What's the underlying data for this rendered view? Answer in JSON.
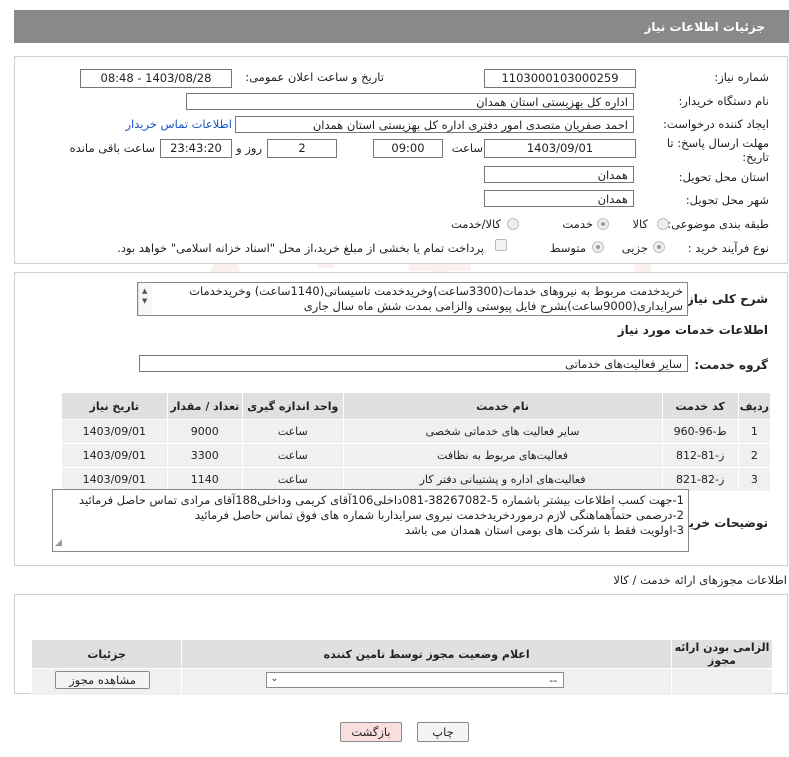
{
  "header": {
    "title": "جزئیات اطلاعات نیاز"
  },
  "form": {
    "need_number_label": "شماره نیاز:",
    "need_number": "1103000103000259",
    "announce_label": "تاریخ و ساعت اعلان عمومی:",
    "announce_value": "1403/08/28 - 08:48",
    "buyer_org_label": "نام دستگاه خریدار:",
    "buyer_org": "اداره کل بهزیستی استان همدان",
    "requester_label": "ایجاد کننده درخواست:",
    "requester": "احمد صفریان متصدی امور دفتری اداره کل بهزیستی استان همدان",
    "contact_link": "اطلاعات تماس خریدار",
    "deadline_label_1": "مهلت ارسال پاسخ: تا",
    "deadline_label_2": "تاریخ:",
    "deadline_date": "1403/09/01",
    "time_label": "ساعت",
    "deadline_time": "09:00",
    "days_value": "2",
    "days_label": "روز و",
    "remaining_time": "23:43:20",
    "remaining_label": "ساعت باقی مانده",
    "province_label": "استان محل تحویل:",
    "province": "همدان",
    "city_label": "شهر محل تحویل:",
    "city": "همدان",
    "category_label": "طبقه بندی موضوعی:",
    "category_options": [
      "کالا",
      "خدمت",
      "کالا/خدمت"
    ],
    "category_selected": "خدمت",
    "process_label": "نوع فرآیند خرید :",
    "process_options": [
      "جزیی",
      "متوسط"
    ],
    "process_selected": "جزیی",
    "payment_note": "پرداخت تمام یا بخشی از مبلغ خرید،از محل \"اسناد خزانه اسلامی\" خواهد بود."
  },
  "summary": {
    "label": "شرح کلی نیاز:",
    "line1": "خریدخدمت مربوط به نیروهای خدمات(3300ساعت)وخریدخدمت تاسیساتی(1140ساعت) وخریدخدمات",
    "line2": "سرایداری(9000ساعت)بشرح فایل پیوستی والزامی بمدت شش ماه سال جاری"
  },
  "services": {
    "section_title": "اطلاعات خدمات مورد نیاز",
    "group_label": "گروه خدمت:",
    "group_value": "سایر فعالیت‌های خدماتی",
    "columns": [
      "ردیف",
      "کد خدمت",
      "نام خدمت",
      "واحد اندازه گیری",
      "تعداد / مقدار",
      "تاریخ نیاز"
    ],
    "rows": [
      [
        "1",
        "ط-96-960",
        "سایر فعالیت های خدماتی شخصی",
        "ساعت",
        "9000",
        "1403/09/01"
      ],
      [
        "2",
        "ز-81-812",
        "فعالیت‌های مربوط به نظافت",
        "ساعت",
        "3300",
        "1403/09/01"
      ],
      [
        "3",
        "ز-82-821",
        "فعالیت‌های اداره و پشتیبانی دفتر کار",
        "ساعت",
        "1140",
        "1403/09/01"
      ]
    ]
  },
  "notes": {
    "label": "توضیحات خریدار:",
    "line1": "1-جهت کسب اطلاعات بیشتر باشماره 5-38267082-081داخلی106آقای کریمی وداخلی188آقای مرادی  تماس حاصل فرمائید",
    "line2": "2-درصمی حتماًهماهنگی لازم درموردخریدخدمت نیروی سرایداربا شماره های فوق تماس حاصل فرمائید",
    "line3": "3-اولویت فقط با شرکت های بومی استان همدان می باشد"
  },
  "permits": {
    "section_title": "اطلاعات مجوزهای ارائه خدمت / کالا",
    "columns": [
      "الزامی بودن ارائه مجوز",
      "اعلام وضعیت مجوز توسط تامین کننده",
      "جزئیات"
    ],
    "select_value": "--",
    "view_button": "مشاهده مجوز"
  },
  "actions": {
    "print": "چاپ",
    "back": "بازگشت"
  },
  "watermark": "AriaTender.neT",
  "colors": {
    "header_bg": "#898989",
    "link": "#1a55c6",
    "back_button_bg": "#f9dede"
  }
}
